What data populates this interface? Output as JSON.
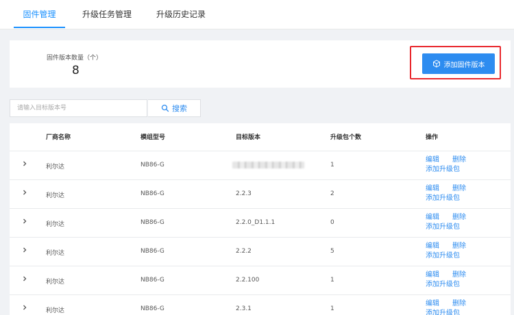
{
  "tabs": [
    {
      "label": "固件管理",
      "active": true
    },
    {
      "label": "升级任务管理",
      "active": false
    },
    {
      "label": "升级历史记录",
      "active": false
    }
  ],
  "stats": {
    "label": "固件版本数量（个）",
    "value": "8"
  },
  "add_button": {
    "label": "添加固件版本",
    "icon": "cube-icon"
  },
  "search": {
    "placeholder": "请输入目标版本号",
    "button_label": "搜索"
  },
  "table": {
    "columns": [
      "厂商名称",
      "模组型号",
      "目标版本",
      "升级包个数",
      "操作"
    ],
    "actions": {
      "edit": "编辑",
      "delete": "删除",
      "add_package": "添加升级包"
    },
    "rows": [
      {
        "vendor": "利尔达",
        "model": "NB86-G",
        "version": "",
        "packages": "1",
        "version_redacted": true
      },
      {
        "vendor": "利尔达",
        "model": "NB86-G",
        "version": "2.2.3",
        "packages": "2"
      },
      {
        "vendor": "利尔达",
        "model": "NB86-G",
        "version": "2.2.0_D1.1.1",
        "packages": "0"
      },
      {
        "vendor": "利尔达",
        "model": "NB86-G",
        "version": "2.2.2",
        "packages": "5"
      },
      {
        "vendor": "利尔达",
        "model": "NB86-G",
        "version": "2.2.100",
        "packages": "1"
      },
      {
        "vendor": "利尔达",
        "model": "NB86-G",
        "version": "2.3.1",
        "packages": "1"
      }
    ]
  },
  "colors": {
    "accent": "#2d8cf0",
    "highlight": "#e8262b"
  }
}
